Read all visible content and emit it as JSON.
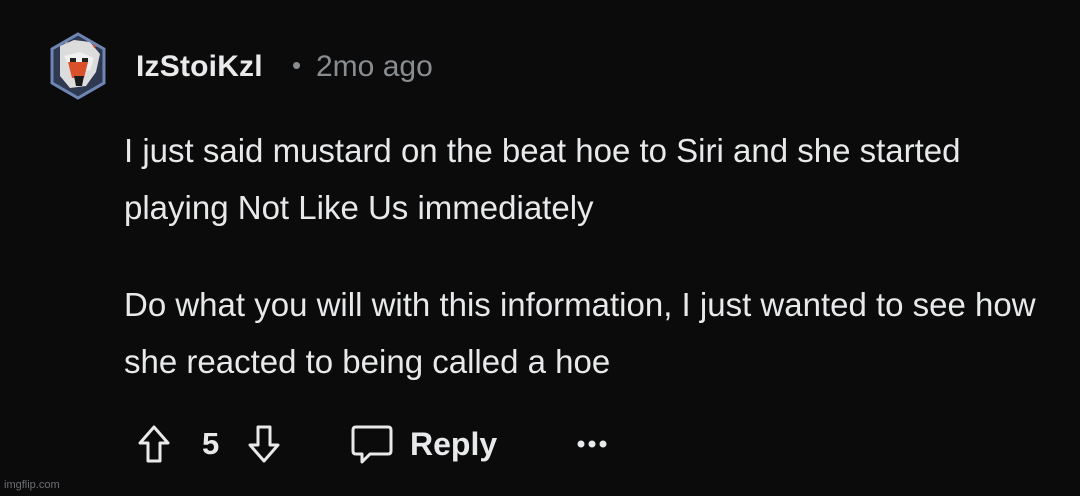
{
  "comment": {
    "username": "IzStoiKzl",
    "separator": "•",
    "timestamp": "2mo ago",
    "paragraphs": [
      "I just said mustard on the beat hoe to Siri and she started playing Not Like Us immediately",
      "Do what you will with this information, I just wanted to see how she reacted to being called a hoe"
    ]
  },
  "actions": {
    "score": "5",
    "reply_label": "Reply",
    "upvote_icon": "arrow-up-outline-icon",
    "downvote_icon": "arrow-down-outline-icon",
    "reply_icon": "speech-bubble-icon",
    "more_icon": "ellipsis-icon"
  },
  "watermark": "imgflip.com",
  "colors": {
    "background": "#0b0b0c",
    "text": "#e8e9ea",
    "muted": "#8a8d90"
  }
}
